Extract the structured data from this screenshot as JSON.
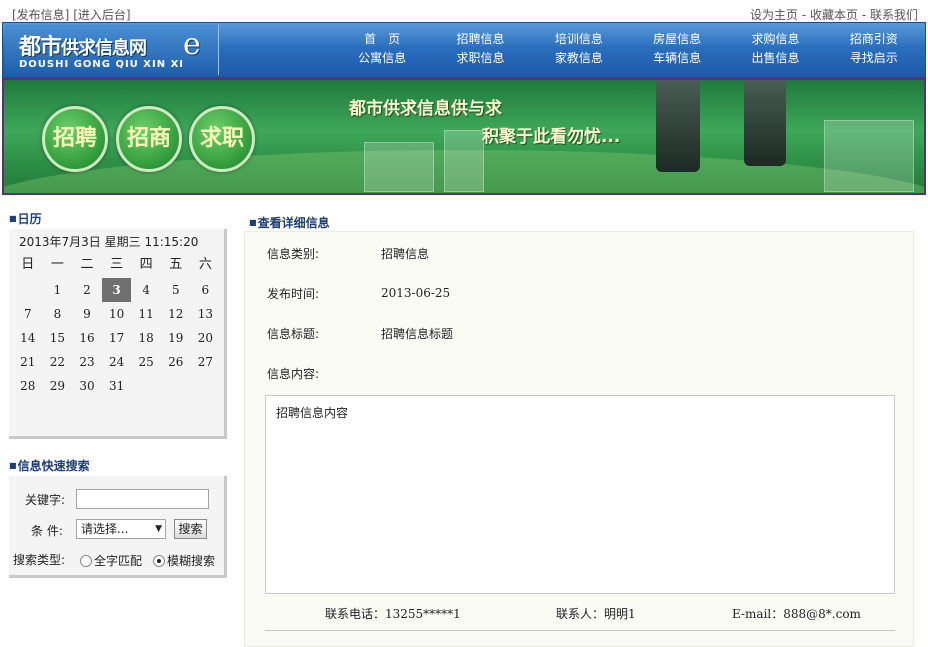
{
  "topbar": {
    "post_info": "[发布信息]",
    "admin": "[进入后台]",
    "set_home": "设为主页",
    "bookmark": "收藏本页",
    "contact": "联系我们"
  },
  "logo": {
    "main": "都市",
    "main2": "供求信息网",
    "sub": "DOUSHI GONG QIU XIN XI"
  },
  "nav": {
    "row1": [
      "首　页",
      "招聘信息",
      "培训信息",
      "房屋信息",
      "求购信息",
      "招商引资"
    ],
    "row2": [
      "公寓信息",
      "求职信息",
      "家教信息",
      "车辆信息",
      "出售信息",
      "寻找启示"
    ]
  },
  "banner": {
    "buttons": [
      "招聘",
      "招商",
      "求职"
    ],
    "slogan1": "都市供求信息供与求",
    "slogan2": "积聚于此看勿忧..."
  },
  "calendar": {
    "title": "日历",
    "datetime": "2013年7月3日 星期三  11:15:20",
    "weekdays": [
      "日",
      "一",
      "二",
      "三",
      "四",
      "五",
      "六"
    ],
    "rows": [
      [
        "",
        "1",
        "2",
        "3",
        "4",
        "5",
        "6"
      ],
      [
        "7",
        "8",
        "9",
        "10",
        "11",
        "12",
        "13"
      ],
      [
        "14",
        "15",
        "16",
        "17",
        "18",
        "19",
        "20"
      ],
      [
        "21",
        "22",
        "23",
        "24",
        "25",
        "26",
        "27"
      ],
      [
        "28",
        "29",
        "30",
        "31",
        "",
        "",
        ""
      ]
    ],
    "today": "3"
  },
  "search": {
    "title": "信息快速搜索",
    "keyword_label": "关键字:",
    "keyword_value": "",
    "condition_label": "条  件:",
    "condition_selected": "请选择...",
    "button": "搜索",
    "type_label": "搜索类型:",
    "option_exact": "全字匹配",
    "option_fuzzy": "模糊搜索",
    "selected_option": "模糊搜索"
  },
  "detail": {
    "title": "查看详细信息",
    "category_label": "信息类别:",
    "category_value": "招聘信息",
    "time_label": "发布时间:",
    "time_value": "2013-06-25",
    "subject_label": "信息标题:",
    "subject_value": "招聘信息标题",
    "content_label": "信息内容:",
    "content_value": "招聘信息内容",
    "phone": "联系电话：13255*****1",
    "contact": "联系人：明明1",
    "email": "E-mail：888@8*.com"
  },
  "colors": {
    "header_blue": "#2a6fbf",
    "section_title": "#1b3f78",
    "banner_green": "#3ea85a",
    "banner_border": "#5b2c7f"
  }
}
